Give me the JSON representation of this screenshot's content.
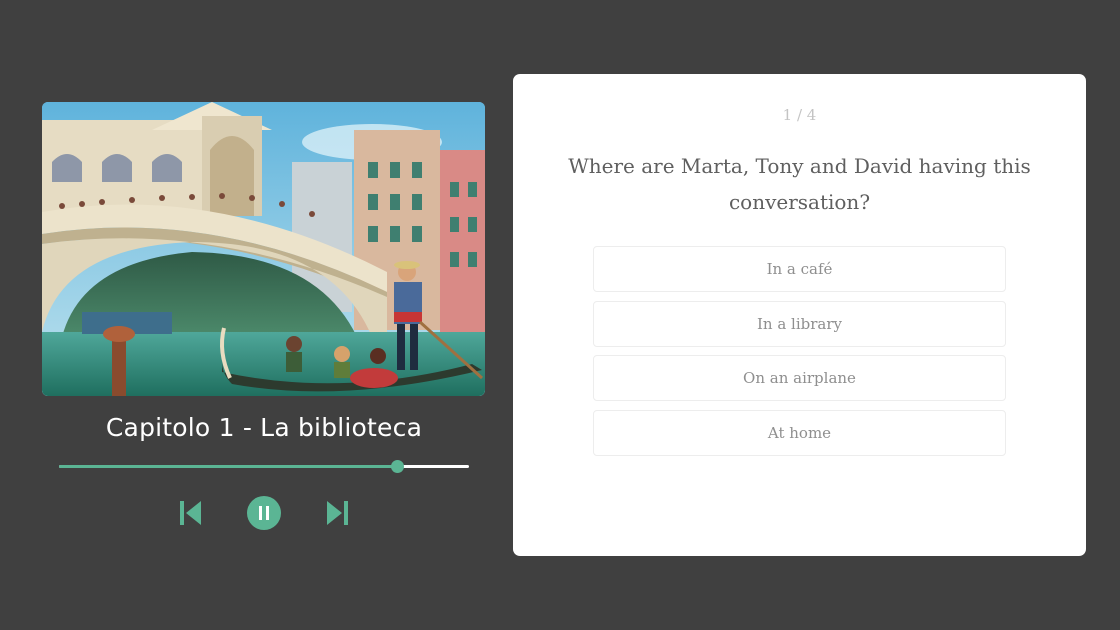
{
  "player": {
    "chapter_title": "Capitolo 1 - La biblioteca",
    "progress_percent": 82.5,
    "cover_icon": "venice-gondola-illustration",
    "controls": {
      "previous_icon": "skip-previous-icon",
      "pause_icon": "pause-icon",
      "next_icon": "skip-next-icon"
    },
    "colors": {
      "accent": "#5bb594",
      "track": "#ffffff",
      "background": "#404040"
    }
  },
  "quiz": {
    "counter": "1 / 4",
    "question": "Where are Marta, Tony and David having this conversation?",
    "options": [
      {
        "label": "In a café"
      },
      {
        "label": "In a library"
      },
      {
        "label": "On an airplane"
      },
      {
        "label": "At home"
      }
    ]
  }
}
